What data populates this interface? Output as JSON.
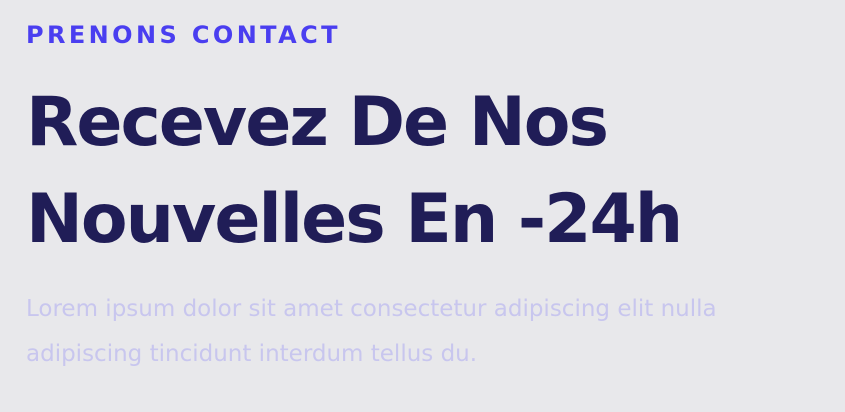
{
  "section": {
    "eyebrow": "PRENONS CONTACT",
    "headline_line1": "Recevez De Nos",
    "headline_line2": "Nouvelles En -24h",
    "description": "Lorem ipsum dolor sit amet consectetur adipiscing elit nulla adipiscing tincidunt interdum tellus du."
  },
  "colors": {
    "background": "#e8e8eb",
    "eyebrow": "#4a3ef0",
    "headline": "#201d57",
    "description": "#c8c6ee"
  }
}
